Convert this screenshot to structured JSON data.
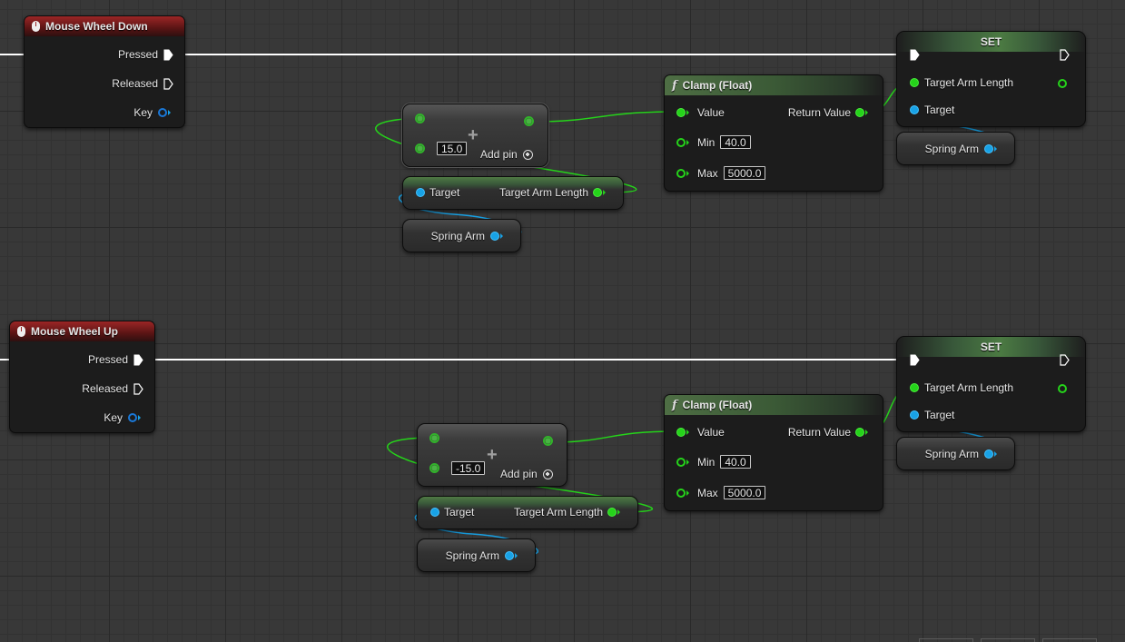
{
  "graph_a": {
    "event": {
      "title": "Mouse Wheel Down",
      "pressed": "Pressed",
      "released": "Released",
      "key": "Key"
    },
    "add": {
      "value": "15.0",
      "add_pin": "Add pin"
    },
    "getter": {
      "target": "Target",
      "output": "Target Arm Length"
    },
    "var": {
      "label": "Spring Arm"
    },
    "clamp": {
      "title": "Clamp (Float)",
      "value": "Value",
      "return_value": "Return Value",
      "min": "Min",
      "min_value": "40.0",
      "max": "Max",
      "max_value": "5000.0"
    },
    "set": {
      "title": "SET",
      "target_arm_length": "Target Arm Length",
      "target": "Target"
    },
    "set_var": {
      "label": "Spring Arm"
    }
  },
  "graph_b": {
    "event": {
      "title": "Mouse Wheel Up",
      "pressed": "Pressed",
      "released": "Released",
      "key": "Key"
    },
    "add": {
      "value": "-15.0",
      "add_pin": "Add pin"
    },
    "getter": {
      "target": "Target",
      "output": "Target Arm Length"
    },
    "var": {
      "label": "Spring Arm"
    },
    "clamp": {
      "title": "Clamp (Float)",
      "value": "Value",
      "return_value": "Return Value",
      "min": "Min",
      "min_value": "40.0",
      "max": "Max",
      "max_value": "5000.0"
    },
    "set": {
      "title": "SET",
      "target_arm_length": "Target Arm Length",
      "target": "Target"
    },
    "set_var": {
      "label": "Spring Arm"
    }
  },
  "colors": {
    "event_header": "#9c2626",
    "float_pin": "#25d31a",
    "object_pin": "#18a2e6",
    "exec_wire": "#ffffff",
    "grid_background": "#383838"
  },
  "icons": [
    "mouse-icon",
    "function-icon",
    "exec-pin-icon",
    "add-pin-icon",
    "plus-icon"
  ]
}
